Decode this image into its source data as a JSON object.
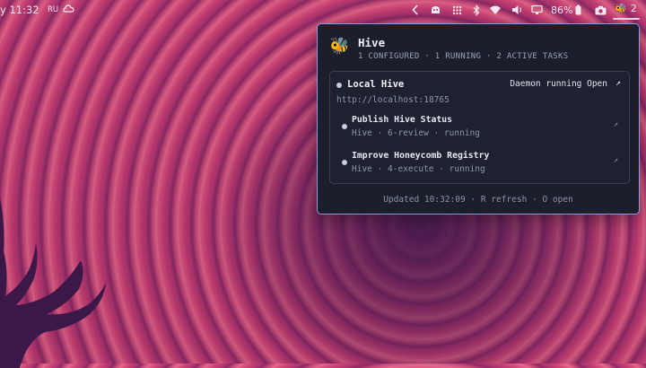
{
  "topbar": {
    "clock": "y 11:32",
    "lang": "RU",
    "battery": "86%",
    "hive_count": "2",
    "icons": [
      "weather-icon",
      "chevron-left-icon",
      "hive-daemon-icon",
      "grid-icon",
      "bluetooth-icon",
      "wifi-icon",
      "volume-icon",
      "display-icon",
      "battery-icon",
      "camera-icon",
      "bee-icon"
    ]
  },
  "popup": {
    "title": "Hive",
    "subtitle": "1 CONFIGURED · 1 RUNNING · 2 ACTIVE TASKS",
    "hive": {
      "name": "Local Hive",
      "status": "Daemon running Open",
      "url": "http://localhost:18765"
    },
    "tasks": [
      {
        "title": "Publish Hive Status",
        "meta": "Hive · 6-review · running"
      },
      {
        "title": "Improve Honeycomb Registry",
        "meta": "Hive · 4-execute · running"
      }
    ],
    "footer": "Updated 10:32:09 · R refresh · O open"
  },
  "colors": {
    "popup_bg": "#1b1f2b",
    "popup_border": "#8f97e8",
    "card_border": "#3a3f52",
    "muted_text": "#8d93aa",
    "wallpaper_pink": "#d9527e",
    "wallpaper_purple": "#4a1d52"
  }
}
